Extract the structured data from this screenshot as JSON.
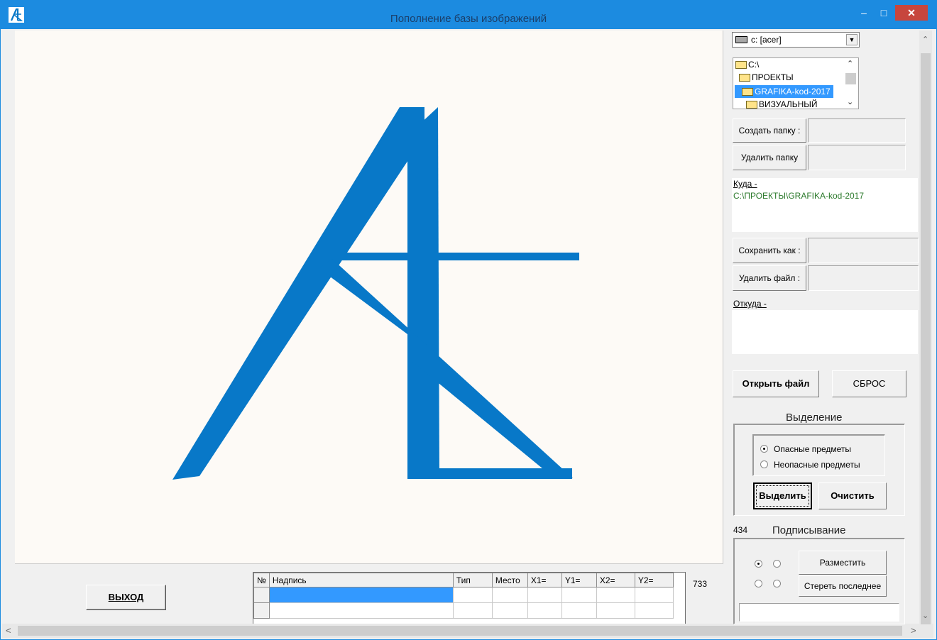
{
  "window": {
    "title": "Пополнение базы изображений",
    "min_glyph": "–",
    "max_glyph": "□",
    "close_glyph": "✕"
  },
  "colors": {
    "titlebar": "#1c8be0",
    "logo_stroke": "#0878c8",
    "path_text": "#2c7a2c",
    "selection": "#3399ff"
  },
  "bottom": {
    "exit_label": "ВЫХОД",
    "counter": "733",
    "grid": {
      "columns": [
        "№",
        "Надпись",
        "Тип",
        "Место",
        "X1=",
        "Y1=",
        "X2=",
        "Y2="
      ],
      "rows": [
        [
          "",
          "",
          "",
          "",
          "",
          "",
          "",
          ""
        ],
        [
          "",
          "",
          "",
          "",
          "",
          "",
          "",
          ""
        ]
      ]
    }
  },
  "panel": {
    "drive": "c: [acer]",
    "dirs": [
      {
        "name": "C:\\"
      },
      {
        "name": "ПРОЕКТЫ"
      },
      {
        "name": "GRAFIKA-kod-2017",
        "selected": true
      },
      {
        "name": "ВИЗУАЛЬНЫЙ"
      }
    ],
    "create_folder_label": "Создать папку :",
    "delete_folder_label": "Удалить папку",
    "to_label": "Куда -",
    "to_path": "C:\\ПРОЕКТЫ\\GRAFIKA-kod-2017",
    "save_as_label": "Сохранить как :",
    "delete_file_label": "Удалить файл :",
    "from_label": "Откуда -",
    "open_file_label": "Открыть файл",
    "reset_label": "СБРОС",
    "selection": {
      "heading": "Выделение",
      "option_dangerous": "Опасные предметы",
      "option_safe": "Неопасные предметы",
      "selected_option": "Опасные предметы",
      "select_button": "Выделить",
      "clear_button": "Очистить"
    },
    "labeling": {
      "count": "434",
      "heading": "Подписывание",
      "place_button": "Разместить",
      "erase_last_button": "Стереть последнее"
    }
  }
}
